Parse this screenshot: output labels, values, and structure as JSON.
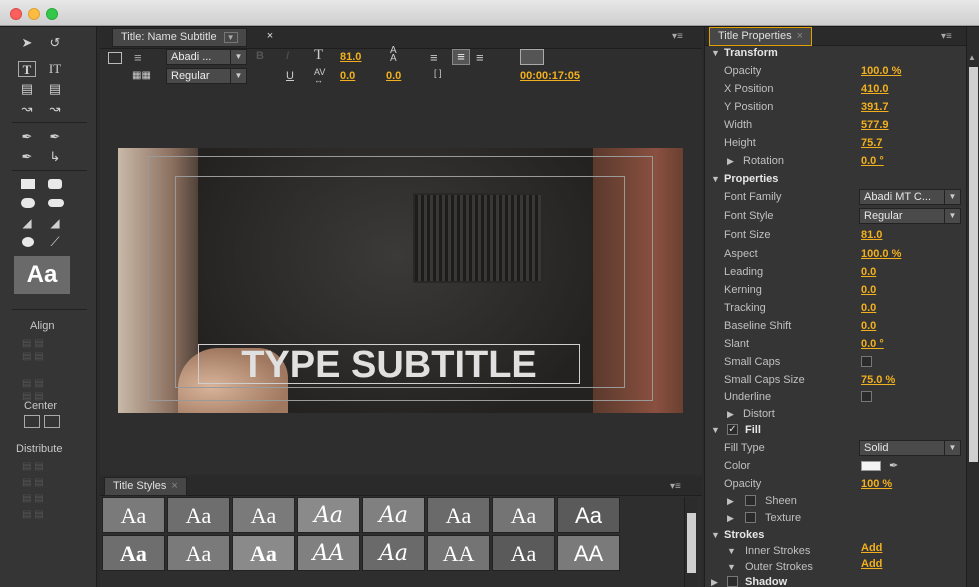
{
  "window": {
    "controls": [
      "close",
      "minimize",
      "zoom"
    ]
  },
  "tools_panel": {
    "preview_label": "Aa",
    "align_label": "Align",
    "center_label": "Center",
    "distribute_label": "Distribute"
  },
  "title_panel": {
    "tab_label": "Title: Name Subtitle",
    "font_family": "Abadi ...",
    "font_style": "Regular",
    "font_size": "81.0",
    "kerning": "0.0",
    "leading": "0.0",
    "timecode": "00:00:17:05",
    "canvas_text": "TYPE SUBTITLE"
  },
  "title_styles": {
    "tab_label": "Title Styles",
    "row1": [
      "Aa",
      "Aa",
      "Aa",
      "Aa",
      "Aa",
      "Aa",
      "Aa",
      "Aa"
    ],
    "row2": [
      "Aa",
      "Aa",
      "Aa",
      "AA",
      "Aa",
      "AA",
      "Aa",
      "AA"
    ]
  },
  "properties": {
    "tab_label": "Title Properties",
    "transform": {
      "section": "Transform",
      "opacity_label": "Opacity",
      "opacity": "100.0 %",
      "x_label": "X Position",
      "x": "410.0",
      "y_label": "Y Position",
      "y": "391.7",
      "width_label": "Width",
      "width": "577.9",
      "height_label": "Height",
      "height": "75.7",
      "rotation_label": "Rotation",
      "rotation": "0.0 °"
    },
    "properties": {
      "section": "Properties",
      "font_family_label": "Font Family",
      "font_family": "Abadi MT C...",
      "font_style_label": "Font Style",
      "font_style": "Regular",
      "font_size_label": "Font Size",
      "font_size": "81.0",
      "aspect_label": "Aspect",
      "aspect": "100.0 %",
      "leading_label": "Leading",
      "leading": "0.0",
      "kerning_label": "Kerning",
      "kerning": "0.0",
      "tracking_label": "Tracking",
      "tracking": "0.0",
      "baseline_label": "Baseline Shift",
      "baseline": "0.0",
      "slant_label": "Slant",
      "slant": "0.0 °",
      "small_caps_label": "Small Caps",
      "small_caps_size_label": "Small Caps Size",
      "small_caps_size": "75.0 %",
      "underline_label": "Underline",
      "distort_label": "Distort"
    },
    "fill": {
      "section": "Fill",
      "fill_type_label": "Fill Type",
      "fill_type": "Solid",
      "color_label": "Color",
      "opacity_label": "Opacity",
      "opacity": "100 %",
      "sheen_label": "Sheen",
      "texture_label": "Texture"
    },
    "strokes": {
      "section": "Strokes",
      "inner_label": "Inner Strokes",
      "inner_add": "Add",
      "outer_label": "Outer Strokes",
      "outer_add": "Add",
      "shadow_label": "Shadow"
    }
  },
  "colors": {
    "accent": "#f2b01e",
    "panel": "#353535",
    "tab_active": "#e0a000"
  }
}
